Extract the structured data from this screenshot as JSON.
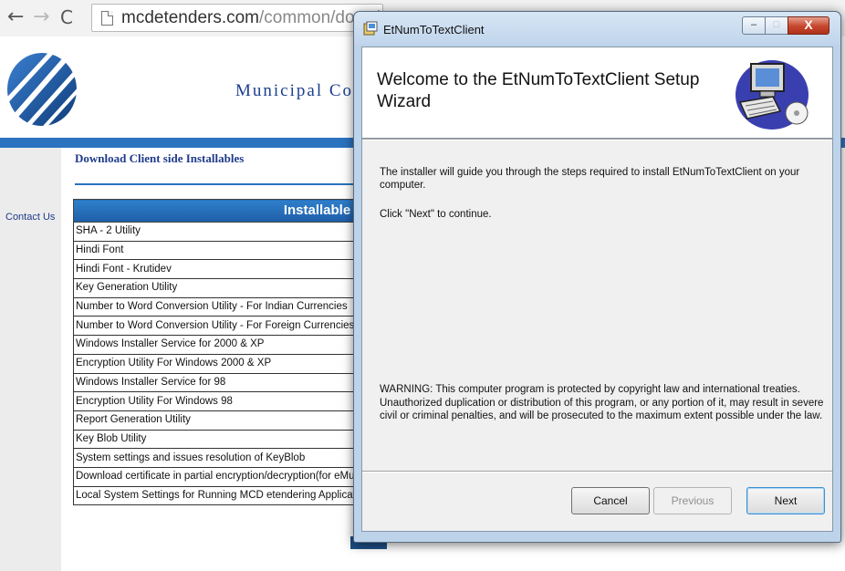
{
  "browser": {
    "back_icon": "←",
    "forward_icon": "→",
    "reload_icon": "C",
    "url_host": "mcdetenders.com",
    "url_path": "/common/downlo"
  },
  "site": {
    "title": "Municipal Co",
    "sidebar_link": "Contact Us",
    "section_title": "Download Client side Installables",
    "table_header": "Installable N",
    "installables": [
      "SHA - 2 Utility",
      "Hindi Font",
      "Hindi Font - Krutidev",
      "Key Generation Utility",
      "Number to Word Conversion Utility - For Indian Currencies",
      "Number to Word Conversion Utility - For Foreign Currencies",
      "Windows Installer Service for 2000 & XP",
      "Encryption Utility For Windows 2000 & XP",
      "Windows Installer Service for 98",
      "Encryption Utility For Windows 98",
      "Report Generation Utility",
      "Key Blob Utility",
      "System settings and issues resolution of KeyBlob",
      "Download certificate in partial encryption/decryption(for eMudr",
      "Local System Settings for Running MCD etendering Application"
    ]
  },
  "installer": {
    "window_title": "EtNumToTextClient",
    "minimize_glyph": "–",
    "maximize_glyph": "□",
    "close_glyph": "X",
    "heading": "Welcome to the EtNumToTextClient Setup Wizard",
    "intro": "The installer will guide you through the steps required to install EtNumToTextClient on your computer.",
    "continue": "Click \"Next\" to continue.",
    "warning": "WARNING: This computer program is protected by copyright law and international treaties. Unauthorized duplication or distribution of this program, or any portion of it, may result in severe civil or criminal penalties, and will be prosecuted to the maximum extent possible under the law.",
    "buttons": {
      "cancel": "Cancel",
      "previous": "Previous",
      "next": "Next"
    }
  },
  "colors": {
    "brand_blue": "#2b73bf",
    "link_blue": "#1e3b8a",
    "close_red": "#c7452c"
  },
  "icons": [
    "back-arrow-icon",
    "forward-arrow-icon",
    "reload-icon",
    "page-icon",
    "logo",
    "installer-app-icon",
    "setup-computer-graphic"
  ]
}
